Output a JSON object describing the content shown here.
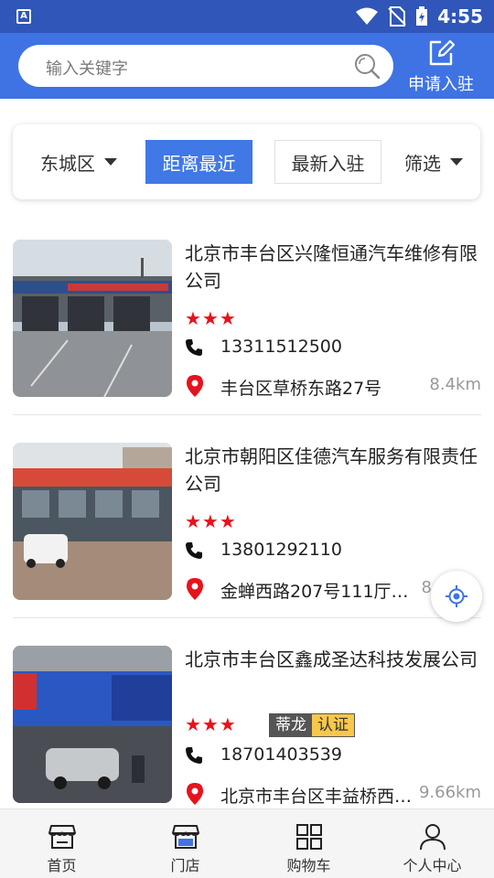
{
  "status_bar": {
    "app_badge": "A",
    "time": "4:55"
  },
  "header": {
    "search_placeholder": "输入关键字",
    "apply_label": "申请入驻"
  },
  "filters": {
    "district": "东城区",
    "nearest": "距离最近",
    "newest": "最新入驻",
    "filter": "筛选"
  },
  "stores": [
    {
      "name": "北京市丰台区兴隆恒通汽车维修有限公司",
      "stars": "★★★",
      "phone": "13311512500",
      "address": "丰台区草桥东路27号",
      "distance": "8.4km"
    },
    {
      "name": "北京市朝阳区佳德汽车服务有限责任公司",
      "stars": "★★★",
      "phone": "13801292110",
      "address": "金蝉西路207号111厅…",
      "distance": "8"
    },
    {
      "name": "北京市丰台区鑫成圣达科技发展公司",
      "stars": "★★★",
      "tag_brand": "蒂龙",
      "tag_cert": "认证",
      "phone": "18701403539",
      "address": "北京市丰台区丰益桥西…",
      "distance": "9.66km"
    }
  ],
  "bottom_nav": [
    {
      "label": "首页",
      "icon": "home-store-icon"
    },
    {
      "label": "门店",
      "icon": "shop-icon"
    },
    {
      "label": "购物车",
      "icon": "grid-icon"
    },
    {
      "label": "个人中心",
      "icon": "person-icon"
    }
  ],
  "colors": {
    "status_bar": "#2f56b8",
    "header": "#3f73e4",
    "active_filter": "#4078e6",
    "star": "#e8121c",
    "pin": "#e8121c",
    "locate": "#3f73e4"
  }
}
